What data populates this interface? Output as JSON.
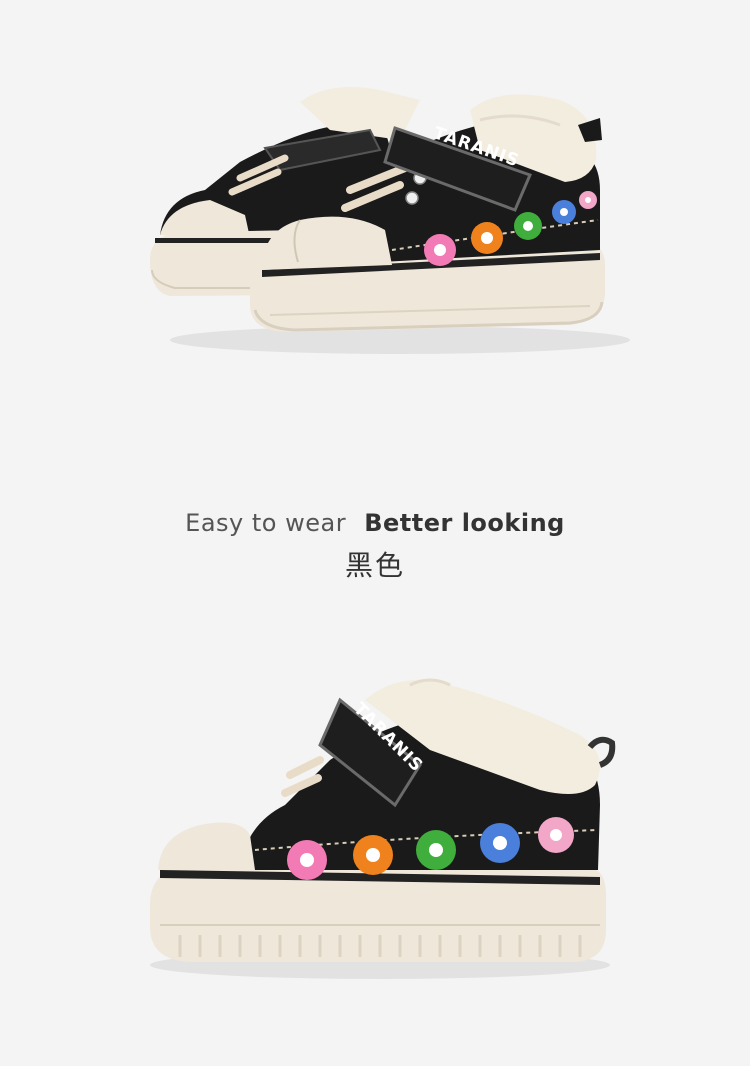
{
  "product_photos": {
    "top_alt": "pair of black canvas baby shoes with flowers",
    "bottom_alt": "single black canvas baby shoe with flowers",
    "strap_brand": "TARANIS"
  },
  "caption": {
    "tagline_light": "Easy to wear",
    "tagline_bold": "Better looking",
    "color_name": "黑色"
  },
  "colors": {
    "background": "#f4f4f4",
    "canvas": "#1a1a1a",
    "sole": "#efe7da",
    "fur": "#f3ede0",
    "flower_pink": "#f27bb6",
    "flower_orange": "#f0821e",
    "flower_green": "#3fae3c",
    "flower_blue": "#4a7fdc"
  }
}
